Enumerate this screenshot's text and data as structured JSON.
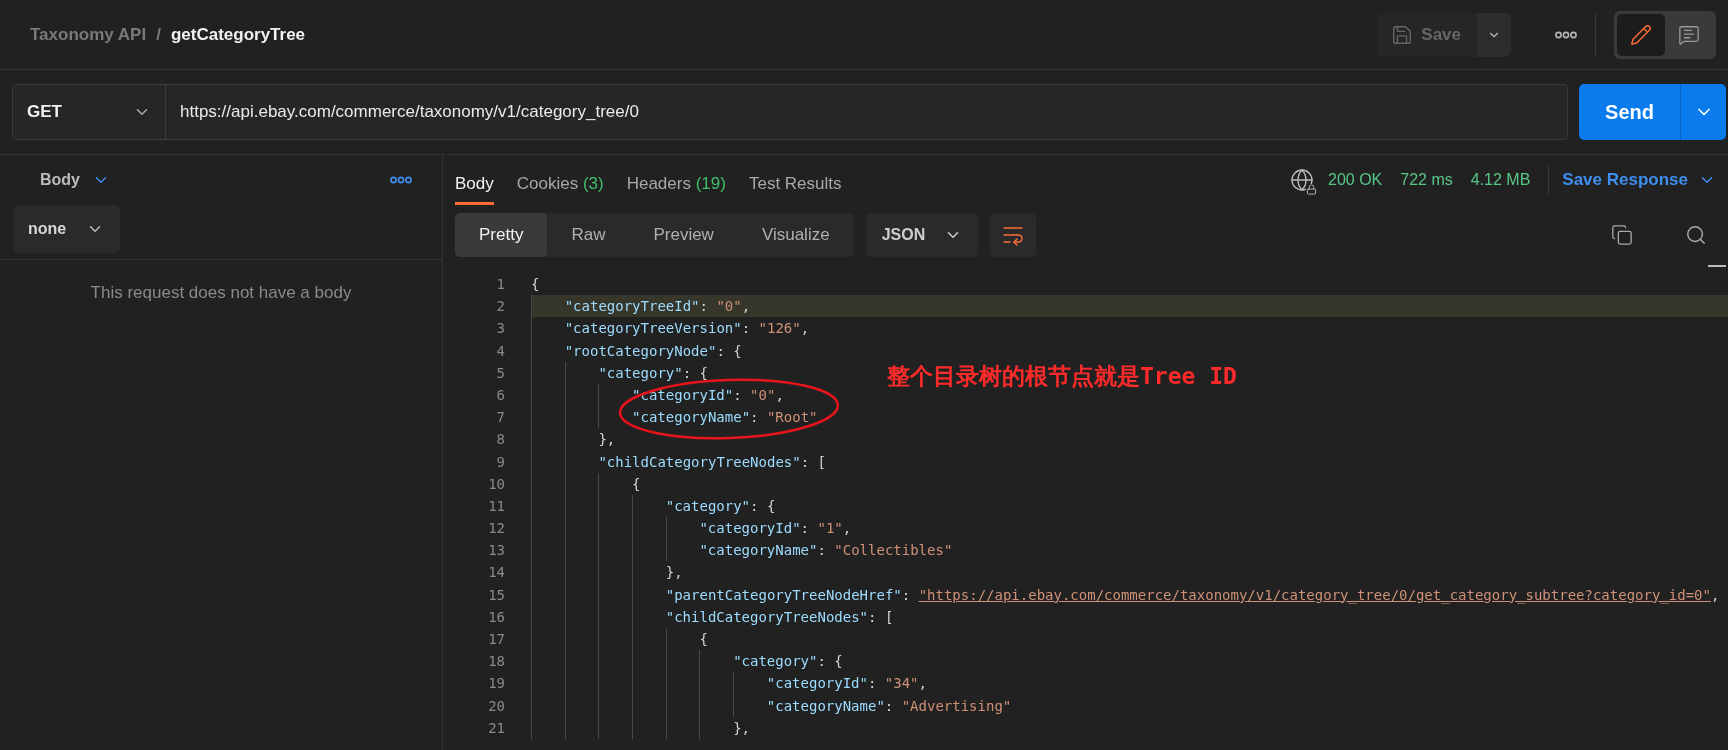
{
  "breadcrumb": {
    "collection": "Taxonomy API",
    "separator": "/",
    "request": "getCategoryTree"
  },
  "header_actions": {
    "save": {
      "label": "Save",
      "disabled": true
    }
  },
  "view_toggle": [
    {
      "kind": "edit",
      "selected": true
    },
    {
      "kind": "comments",
      "selected": false
    }
  ],
  "request": {
    "method": "GET",
    "url": "https://api.ebay.com/commerce/taxonomy/v1/category_tree/0",
    "send": "Send"
  },
  "request_body": {
    "tab": "Body",
    "mode": "none",
    "empty_message": "This request does not have a body"
  },
  "response": {
    "tabs": [
      {
        "label": "Body",
        "selected": true
      },
      {
        "label": "Cookies",
        "count": "(3)",
        "selected": false
      },
      {
        "label": "Headers",
        "count": "(19)",
        "selected": false
      },
      {
        "label": "Test Results",
        "selected": false
      }
    ],
    "status": "200 OK",
    "time": "722 ms",
    "size": "4.12 MB",
    "save_response": "Save Response",
    "formats": [
      {
        "label": "Pretty",
        "selected": true
      },
      {
        "label": "Raw",
        "selected": false
      },
      {
        "label": "Preview",
        "selected": false
      },
      {
        "label": "Visualize",
        "selected": false
      }
    ],
    "language": "JSON",
    "wrap_lines": true,
    "code_lines": [
      {
        "number": "1",
        "highlighted": false,
        "tokens": [
          {
            "kind": "punct",
            "text": "{"
          }
        ]
      },
      {
        "number": "2",
        "highlighted": true,
        "tokens": [
          {
            "kind": "key",
            "text": "    \"categoryTreeId\""
          },
          {
            "kind": "punct",
            "text": ": "
          },
          {
            "kind": "string",
            "text": "\"0\""
          },
          {
            "kind": "punct",
            "text": ","
          }
        ]
      },
      {
        "number": "3",
        "highlighted": false,
        "tokens": [
          {
            "kind": "key",
            "text": "    \"categoryTreeVersion\""
          },
          {
            "kind": "punct",
            "text": ": "
          },
          {
            "kind": "string",
            "text": "\"126\""
          },
          {
            "kind": "punct",
            "text": ","
          }
        ]
      },
      {
        "number": "4",
        "highlighted": false,
        "tokens": [
          {
            "kind": "key",
            "text": "    \"rootCategoryNode\""
          },
          {
            "kind": "punct",
            "text": ": {"
          }
        ]
      },
      {
        "number": "5",
        "highlighted": false,
        "tokens": [
          {
            "kind": "key",
            "text": "        \"category\""
          },
          {
            "kind": "punct",
            "text": ": {"
          }
        ]
      },
      {
        "number": "6",
        "highlighted": false,
        "tokens": [
          {
            "kind": "key",
            "text": "            \"categoryId\""
          },
          {
            "kind": "punct",
            "text": ": "
          },
          {
            "kind": "string",
            "text": "\"0\""
          },
          {
            "kind": "punct",
            "text": ","
          }
        ]
      },
      {
        "number": "7",
        "highlighted": false,
        "tokens": [
          {
            "kind": "key",
            "text": "            \"categoryName\""
          },
          {
            "kind": "punct",
            "text": ": "
          },
          {
            "kind": "string",
            "text": "\"Root\""
          }
        ]
      },
      {
        "number": "8",
        "highlighted": false,
        "tokens": [
          {
            "kind": "punct",
            "text": "        },"
          }
        ]
      },
      {
        "number": "9",
        "highlighted": false,
        "tokens": [
          {
            "kind": "key",
            "text": "        \"childCategoryTreeNodes\""
          },
          {
            "kind": "punct",
            "text": ": ["
          }
        ]
      },
      {
        "number": "10",
        "highlighted": false,
        "tokens": [
          {
            "kind": "punct",
            "text": "            {"
          }
        ]
      },
      {
        "number": "11",
        "highlighted": false,
        "tokens": [
          {
            "kind": "key",
            "text": "                \"category\""
          },
          {
            "kind": "punct",
            "text": ": {"
          }
        ]
      },
      {
        "number": "12",
        "highlighted": false,
        "tokens": [
          {
            "kind": "key",
            "text": "                    \"categoryId\""
          },
          {
            "kind": "punct",
            "text": ": "
          },
          {
            "kind": "string",
            "text": "\"1\""
          },
          {
            "kind": "punct",
            "text": ","
          }
        ]
      },
      {
        "number": "13",
        "highlighted": false,
        "tokens": [
          {
            "kind": "key",
            "text": "                    \"categoryName\""
          },
          {
            "kind": "punct",
            "text": ": "
          },
          {
            "kind": "string",
            "text": "\"Collectibles\""
          }
        ]
      },
      {
        "number": "14",
        "highlighted": false,
        "tokens": [
          {
            "kind": "punct",
            "text": "                },"
          }
        ]
      },
      {
        "number": "15",
        "highlighted": false,
        "tokens": [
          {
            "kind": "key",
            "text": "                \"parentCategoryTreeNodeHref\""
          },
          {
            "kind": "punct",
            "text": ": "
          },
          {
            "kind": "link",
            "text": "\"https://api.ebay.com/commerce/taxonomy/v1/category_tree/0/get_category_subtree?category_id=0\""
          },
          {
            "kind": "punct",
            "text": ","
          }
        ]
      },
      {
        "number": "16",
        "highlighted": false,
        "tokens": [
          {
            "kind": "key",
            "text": "                \"childCategoryTreeNodes\""
          },
          {
            "kind": "punct",
            "text": ": ["
          }
        ]
      },
      {
        "number": "17",
        "highlighted": false,
        "tokens": [
          {
            "kind": "punct",
            "text": "                    {"
          }
        ]
      },
      {
        "number": "18",
        "highlighted": false,
        "tokens": [
          {
            "kind": "key",
            "text": "                        \"category\""
          },
          {
            "kind": "punct",
            "text": ": {"
          }
        ]
      },
      {
        "number": "19",
        "highlighted": false,
        "tokens": [
          {
            "kind": "key",
            "text": "                            \"categoryId\""
          },
          {
            "kind": "punct",
            "text": ": "
          },
          {
            "kind": "string",
            "text": "\"34\""
          },
          {
            "kind": "punct",
            "text": ","
          }
        ]
      },
      {
        "number": "20",
        "highlighted": false,
        "tokens": [
          {
            "kind": "key",
            "text": "                            \"categoryName\""
          },
          {
            "kind": "punct",
            "text": ": "
          },
          {
            "kind": "string",
            "text": "\"Advertising\""
          }
        ]
      },
      {
        "number": "21",
        "highlighted": false,
        "tokens": [
          {
            "kind": "punct",
            "text": "                        },"
          }
        ]
      }
    ],
    "annotation": {
      "text": "整个目录树的根节点就是Tree ID"
    }
  }
}
